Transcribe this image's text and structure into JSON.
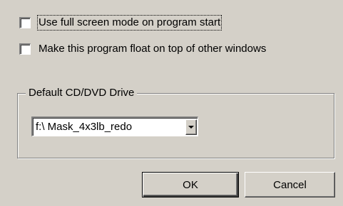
{
  "options": {
    "fullscreen": {
      "label": "Use full screen mode on program start",
      "checked": false
    },
    "float_on_top": {
      "label": "Make this program float on top of other windows",
      "checked": false
    }
  },
  "drive_group": {
    "legend": "Default CD/DVD Drive",
    "selected_drive": "f:\\ Mask_4x3lb_redo"
  },
  "buttons": {
    "ok_label": "OK",
    "cancel_label": "Cancel"
  },
  "colors": {
    "dialog_background": "#d4d0c8",
    "field_background": "#ffffff",
    "shadow": "#808080",
    "highlight": "#ffffff"
  },
  "icons": {
    "combo_arrow": "chevron-down-icon"
  }
}
